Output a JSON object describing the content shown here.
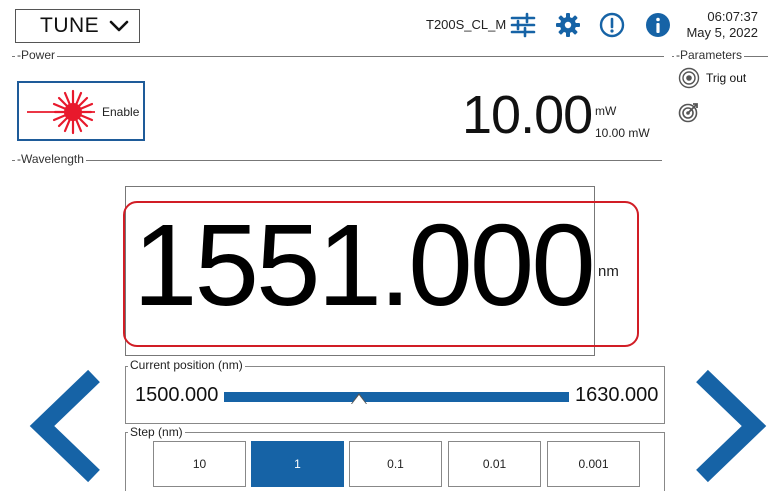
{
  "header": {
    "mode": "TUNE",
    "device_name": "T200S_CL_M",
    "time": "06:07:37",
    "date": "May 5, 2022",
    "icons": [
      "sliders-icon",
      "gear-icon",
      "alert-icon",
      "info-icon"
    ]
  },
  "power": {
    "section_label": "Power",
    "enable_label": "Enable",
    "value": "10.00",
    "unit": "mW",
    "setpoint": "10.00 mW"
  },
  "parameters": {
    "section_label": "Parameters",
    "items": [
      {
        "label": "Trig out",
        "icon": "trigger-out-icon"
      },
      {
        "label": "",
        "icon": "target-icon"
      }
    ]
  },
  "wavelength": {
    "section_label": "Wavelength",
    "value": "1551.000",
    "unit": "nm"
  },
  "position": {
    "label": "Current position (nm)",
    "min": "1500.000",
    "max": "1630.000",
    "fraction": 0.392
  },
  "step": {
    "label": "Step (nm)",
    "options": [
      "10",
      "1",
      "0.1",
      "0.01",
      "0.001"
    ],
    "selected": "1"
  },
  "colors": {
    "accent_blue": "#1663a6",
    "highlight_red": "#d11d25",
    "laser_red": "#e8192c"
  }
}
